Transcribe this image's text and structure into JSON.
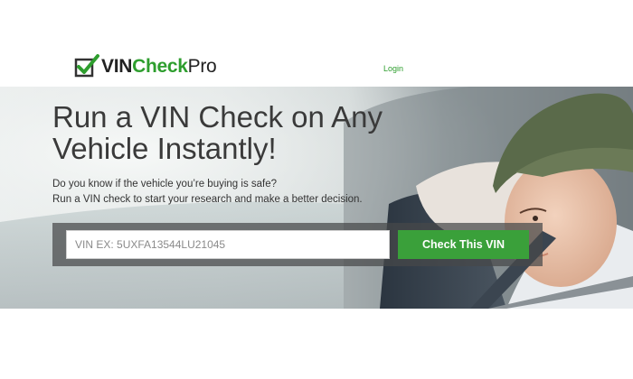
{
  "brand": {
    "name_vin": "VIN",
    "name_check": "Check",
    "name_pro": "Pro",
    "green": "#2e9e2e",
    "logo_icon": "checkbox-checkmark-icon"
  },
  "nav": {
    "login_label": "Login"
  },
  "hero": {
    "headline": "Run a VIN Check on Any Vehicle Instantly!",
    "subtext_line1": "Do you know if the vehicle you’re buying is safe?",
    "subtext_line2": "Run a VIN check to start your research and make a better decision.",
    "background_image": "child-in-car-seat-photo"
  },
  "search": {
    "placeholder": "VIN EX: 5UXFA13544LU21045",
    "button_label": "Check This VIN",
    "button_color": "#3aa03a"
  }
}
